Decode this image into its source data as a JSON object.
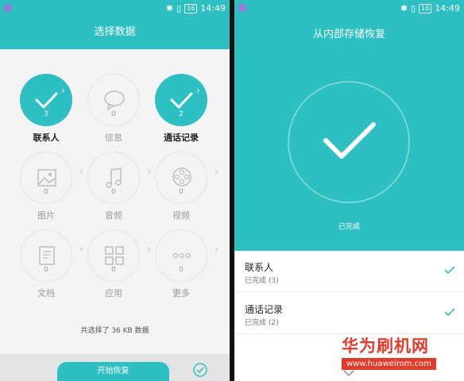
{
  "status_bar": {
    "time": "14:49",
    "battery": "16"
  },
  "left": {
    "title": "选择数据",
    "items": [
      {
        "label": "联系人",
        "count": "3",
        "icon": "check-icon",
        "selected": true
      },
      {
        "label": "信息",
        "count": "0",
        "icon": "message-icon",
        "selected": false
      },
      {
        "label": "通话记录",
        "count": "2",
        "icon": "check-icon",
        "selected": true
      },
      {
        "label": "图片",
        "count": "0",
        "icon": "picture-icon",
        "selected": false
      },
      {
        "label": "音频",
        "count": "0",
        "icon": "music-note-icon",
        "selected": false
      },
      {
        "label": "视频",
        "count": "0",
        "icon": "film-reel-icon",
        "selected": false
      },
      {
        "label": "文档",
        "count": "0",
        "icon": "document-icon",
        "selected": false
      },
      {
        "label": "应用",
        "count": "0",
        "icon": "apps-grid-icon",
        "selected": false
      },
      {
        "label": "更多",
        "count": "0",
        "icon": "more-dots-icon",
        "selected": false
      }
    ],
    "summary": "共选择了 36 KB 数据",
    "start_button": "开始恢复"
  },
  "right": {
    "title": "从内部存储恢复",
    "status": "已完成",
    "results": [
      {
        "title": "联系人",
        "subtitle": "已完成 (3)"
      },
      {
        "title": "通话记录",
        "subtitle": "已完成 (2)"
      }
    ]
  },
  "watermark": {
    "title": "华为刷机网",
    "url": "www.huaweirom.com"
  },
  "colors": {
    "accent": "#2cc0c2",
    "watermark": "#e53a2a"
  }
}
